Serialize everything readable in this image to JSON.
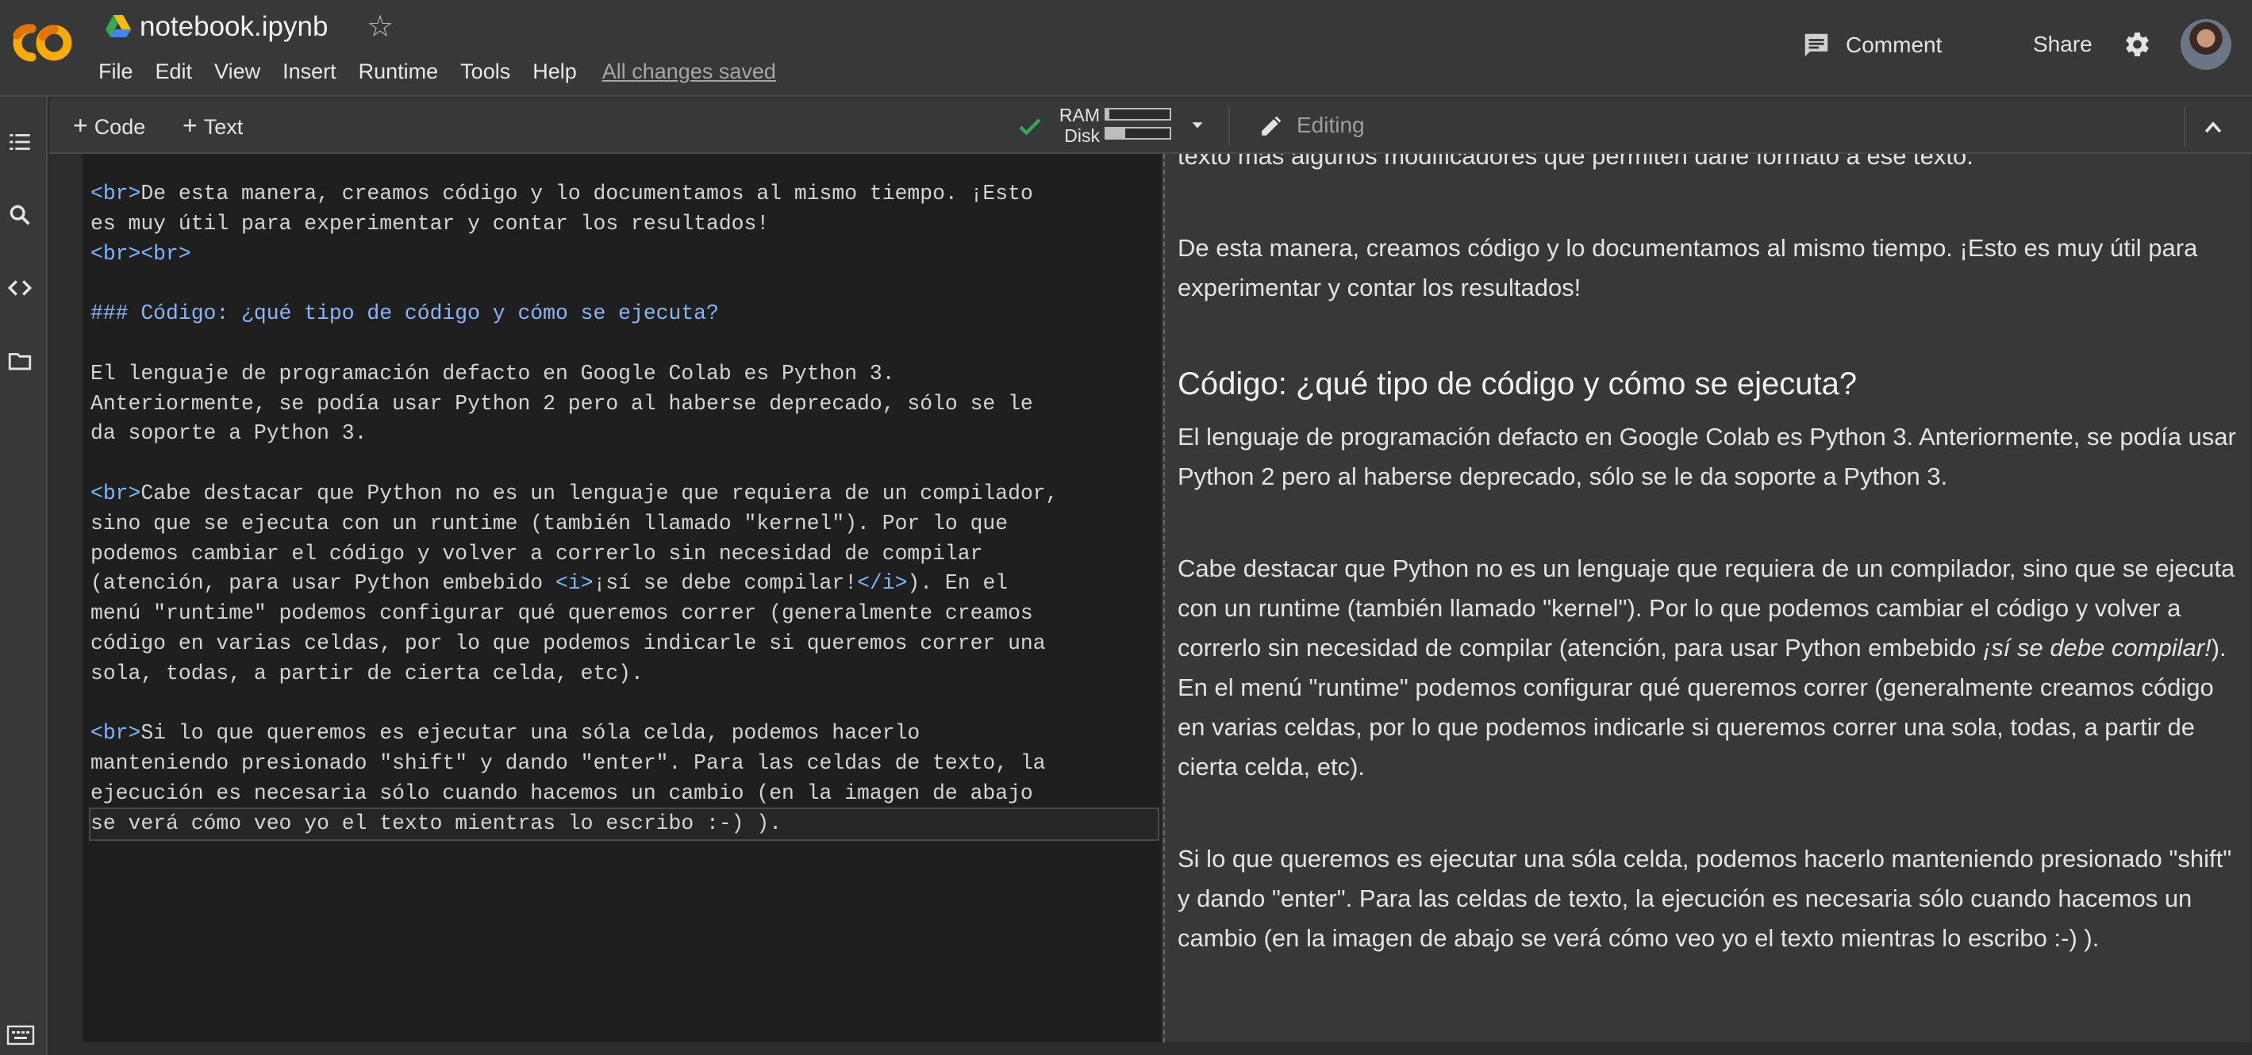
{
  "app": {
    "title": "notebook.ipynb",
    "logo_text": "CO",
    "accent_color": "#f9ab00"
  },
  "menu": [
    "File",
    "Edit",
    "View",
    "Insert",
    "Runtime",
    "Tools",
    "Help"
  ],
  "status": {
    "save_state": "All changes saved"
  },
  "header_actions": {
    "comment": "Comment",
    "share": "Share"
  },
  "toolbar": {
    "code_label": "Code",
    "text_label": "Text",
    "ram_label": "RAM",
    "disk_label": "Disk",
    "ram_usage": 0.05,
    "disk_usage": 0.3,
    "mode_label": "Editing"
  },
  "editor": {
    "lines": [
      [
        {
          "t": "<br>",
          "c": "tag"
        },
        {
          "t": "De esta manera, creamos código y lo documentamos al mismo tiempo. ¡Esto"
        }
      ],
      [
        {
          "t": "es muy útil para experimentar y contar los resultados!"
        }
      ],
      [
        {
          "t": "<br><br>",
          "c": "tag"
        }
      ],
      [
        {
          "t": ""
        }
      ],
      [
        {
          "t": "### Código: ¿qué tipo de código y cómo se ejecuta?",
          "c": "hd"
        }
      ],
      [
        {
          "t": ""
        }
      ],
      [
        {
          "t": "El lenguaje de programación defacto en Google Colab es Python 3."
        }
      ],
      [
        {
          "t": "Anteriormente, se podía usar Python 2 pero al haberse deprecado, sólo se le"
        }
      ],
      [
        {
          "t": "da soporte a Python 3."
        }
      ],
      [
        {
          "t": ""
        }
      ],
      [
        {
          "t": "<br>",
          "c": "tag"
        },
        {
          "t": "Cabe destacar que Python no es un lenguaje que requiera de un compilador,"
        }
      ],
      [
        {
          "t": "sino que se ejecuta con un runtime (también llamado \"kernel\"). Por lo que"
        }
      ],
      [
        {
          "t": "podemos cambiar el código y volver a correrlo sin necesidad de compilar"
        }
      ],
      [
        {
          "t": "(atención, para usar Python embebido "
        },
        {
          "t": "<i>",
          "c": "tag"
        },
        {
          "t": "¡sí se debe compilar!"
        },
        {
          "t": "</i>",
          "c": "tag"
        },
        {
          "t": "). En el"
        }
      ],
      [
        {
          "t": "menú \"runtime\" podemos configurar qué queremos correr (generalmente creamos"
        }
      ],
      [
        {
          "t": "código en varias celdas, por lo que podemos indicarle si queremos correr una"
        }
      ],
      [
        {
          "t": "sola, todas, a partir de cierta celda, etc)."
        }
      ],
      [
        {
          "t": ""
        }
      ],
      [
        {
          "t": "<br>",
          "c": "tag"
        },
        {
          "t": "Si lo que queremos es ejecutar una sóla celda, podemos hacerlo"
        }
      ],
      [
        {
          "t": "manteniendo presionado \"shift\" y dando \"enter\". Para las celdas de texto, la"
        }
      ],
      [
        {
          "t": "ejecución es necesaria sólo cuando hacemos un cambio (en la imagen de abajo"
        }
      ],
      [
        {
          "t": "se verá cómo veo yo el texto mientras lo escribo :-) )."
        }
      ]
    ],
    "current_line": 21
  },
  "preview": {
    "intro_tail": "texto más algunos modificadores que permiten darle formato a ese texto.",
    "p1": "De esta manera, creamos código y lo documentamos al mismo tiempo. ¡Esto es muy útil para experimentar y contar los resultados!",
    "heading": "Código: ¿qué tipo de código y cómo se ejecuta?",
    "p2": "El lenguaje de programación defacto en Google Colab es Python 3. Anteriormente, se podía usar Python 2 pero al haberse deprecado, sólo se le da soporte a Python 3.",
    "p3_before": "Cabe destacar que Python no es un lenguaje que requiera de un compilador, sino que se ejecuta con un runtime (también llamado \"kernel\"). Por lo que podemos cambiar el código y volver a correrlo sin necesidad de compilar (atención, para usar Python embebido ",
    "p3_em": "¡sí se debe compilar!",
    "p3_after": "). En el menú \"runtime\" podemos configurar qué queremos correr (generalmente creamos código en varias celdas, por lo que podemos indicarle si queremos correr una sola, todas, a partir de cierta celda, etc).",
    "p4": "Si lo que queremos es ejecutar una sóla celda, podemos hacerlo manteniendo presionado \"shift\" y dando \"enter\". Para las celdas de texto, la ejecución es necesaria sólo cuando hacemos un cambio (en la imagen de abajo se verá cómo veo yo el texto mientras lo escribo :-) )."
  },
  "sidebar_icons": [
    "table-of-contents-icon",
    "search-icon",
    "code-snippets-icon",
    "files-folder-icon",
    "terminal-icon"
  ]
}
